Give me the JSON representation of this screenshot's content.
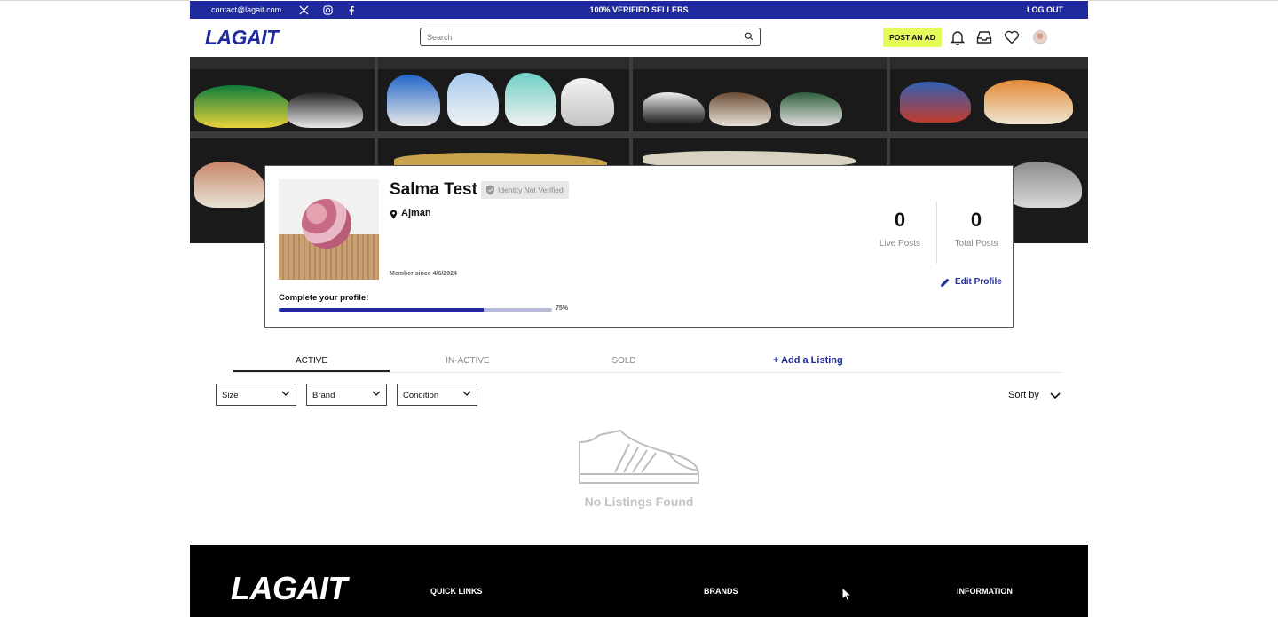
{
  "topbar": {
    "email": "contact@lagait.com",
    "center": "100% VERIFIED SELLERS",
    "logout": "LOG OUT"
  },
  "header": {
    "logo": "LAGAIT",
    "search_placeholder": "Search",
    "post_ad": "POST AN AD"
  },
  "profile": {
    "name": "Salma Test",
    "verification": "Identity Not Verified",
    "location": "Ajman",
    "member_since": "Member since 4/6/2024",
    "complete_label": "Complete your profile!",
    "progress_percent": 75,
    "progress_label": "75%",
    "live_posts": "0",
    "live_posts_label": "Live Posts",
    "total_posts": "0",
    "total_posts_label": "Total Posts",
    "edit_label": "Edit Profile"
  },
  "tabs": [
    {
      "label": "ACTIVE",
      "active": true
    },
    {
      "label": "IN-ACTIVE",
      "active": false
    },
    {
      "label": "SOLD",
      "active": false
    }
  ],
  "add_listing": "+ Add a Listing",
  "filters": [
    {
      "label": "Size"
    },
    {
      "label": "Brand"
    },
    {
      "label": "Condition"
    }
  ],
  "sort_label": "Sort by",
  "empty_state": "No Listings Found",
  "footer": {
    "logo": "LAGAIT",
    "quick_links": "QUICK LINKS",
    "brands": "BRANDS",
    "information": "INFORMATION"
  },
  "colors": {
    "brand": "#1f2b9c",
    "accent": "#e5fb5a",
    "footer": "#000000"
  }
}
